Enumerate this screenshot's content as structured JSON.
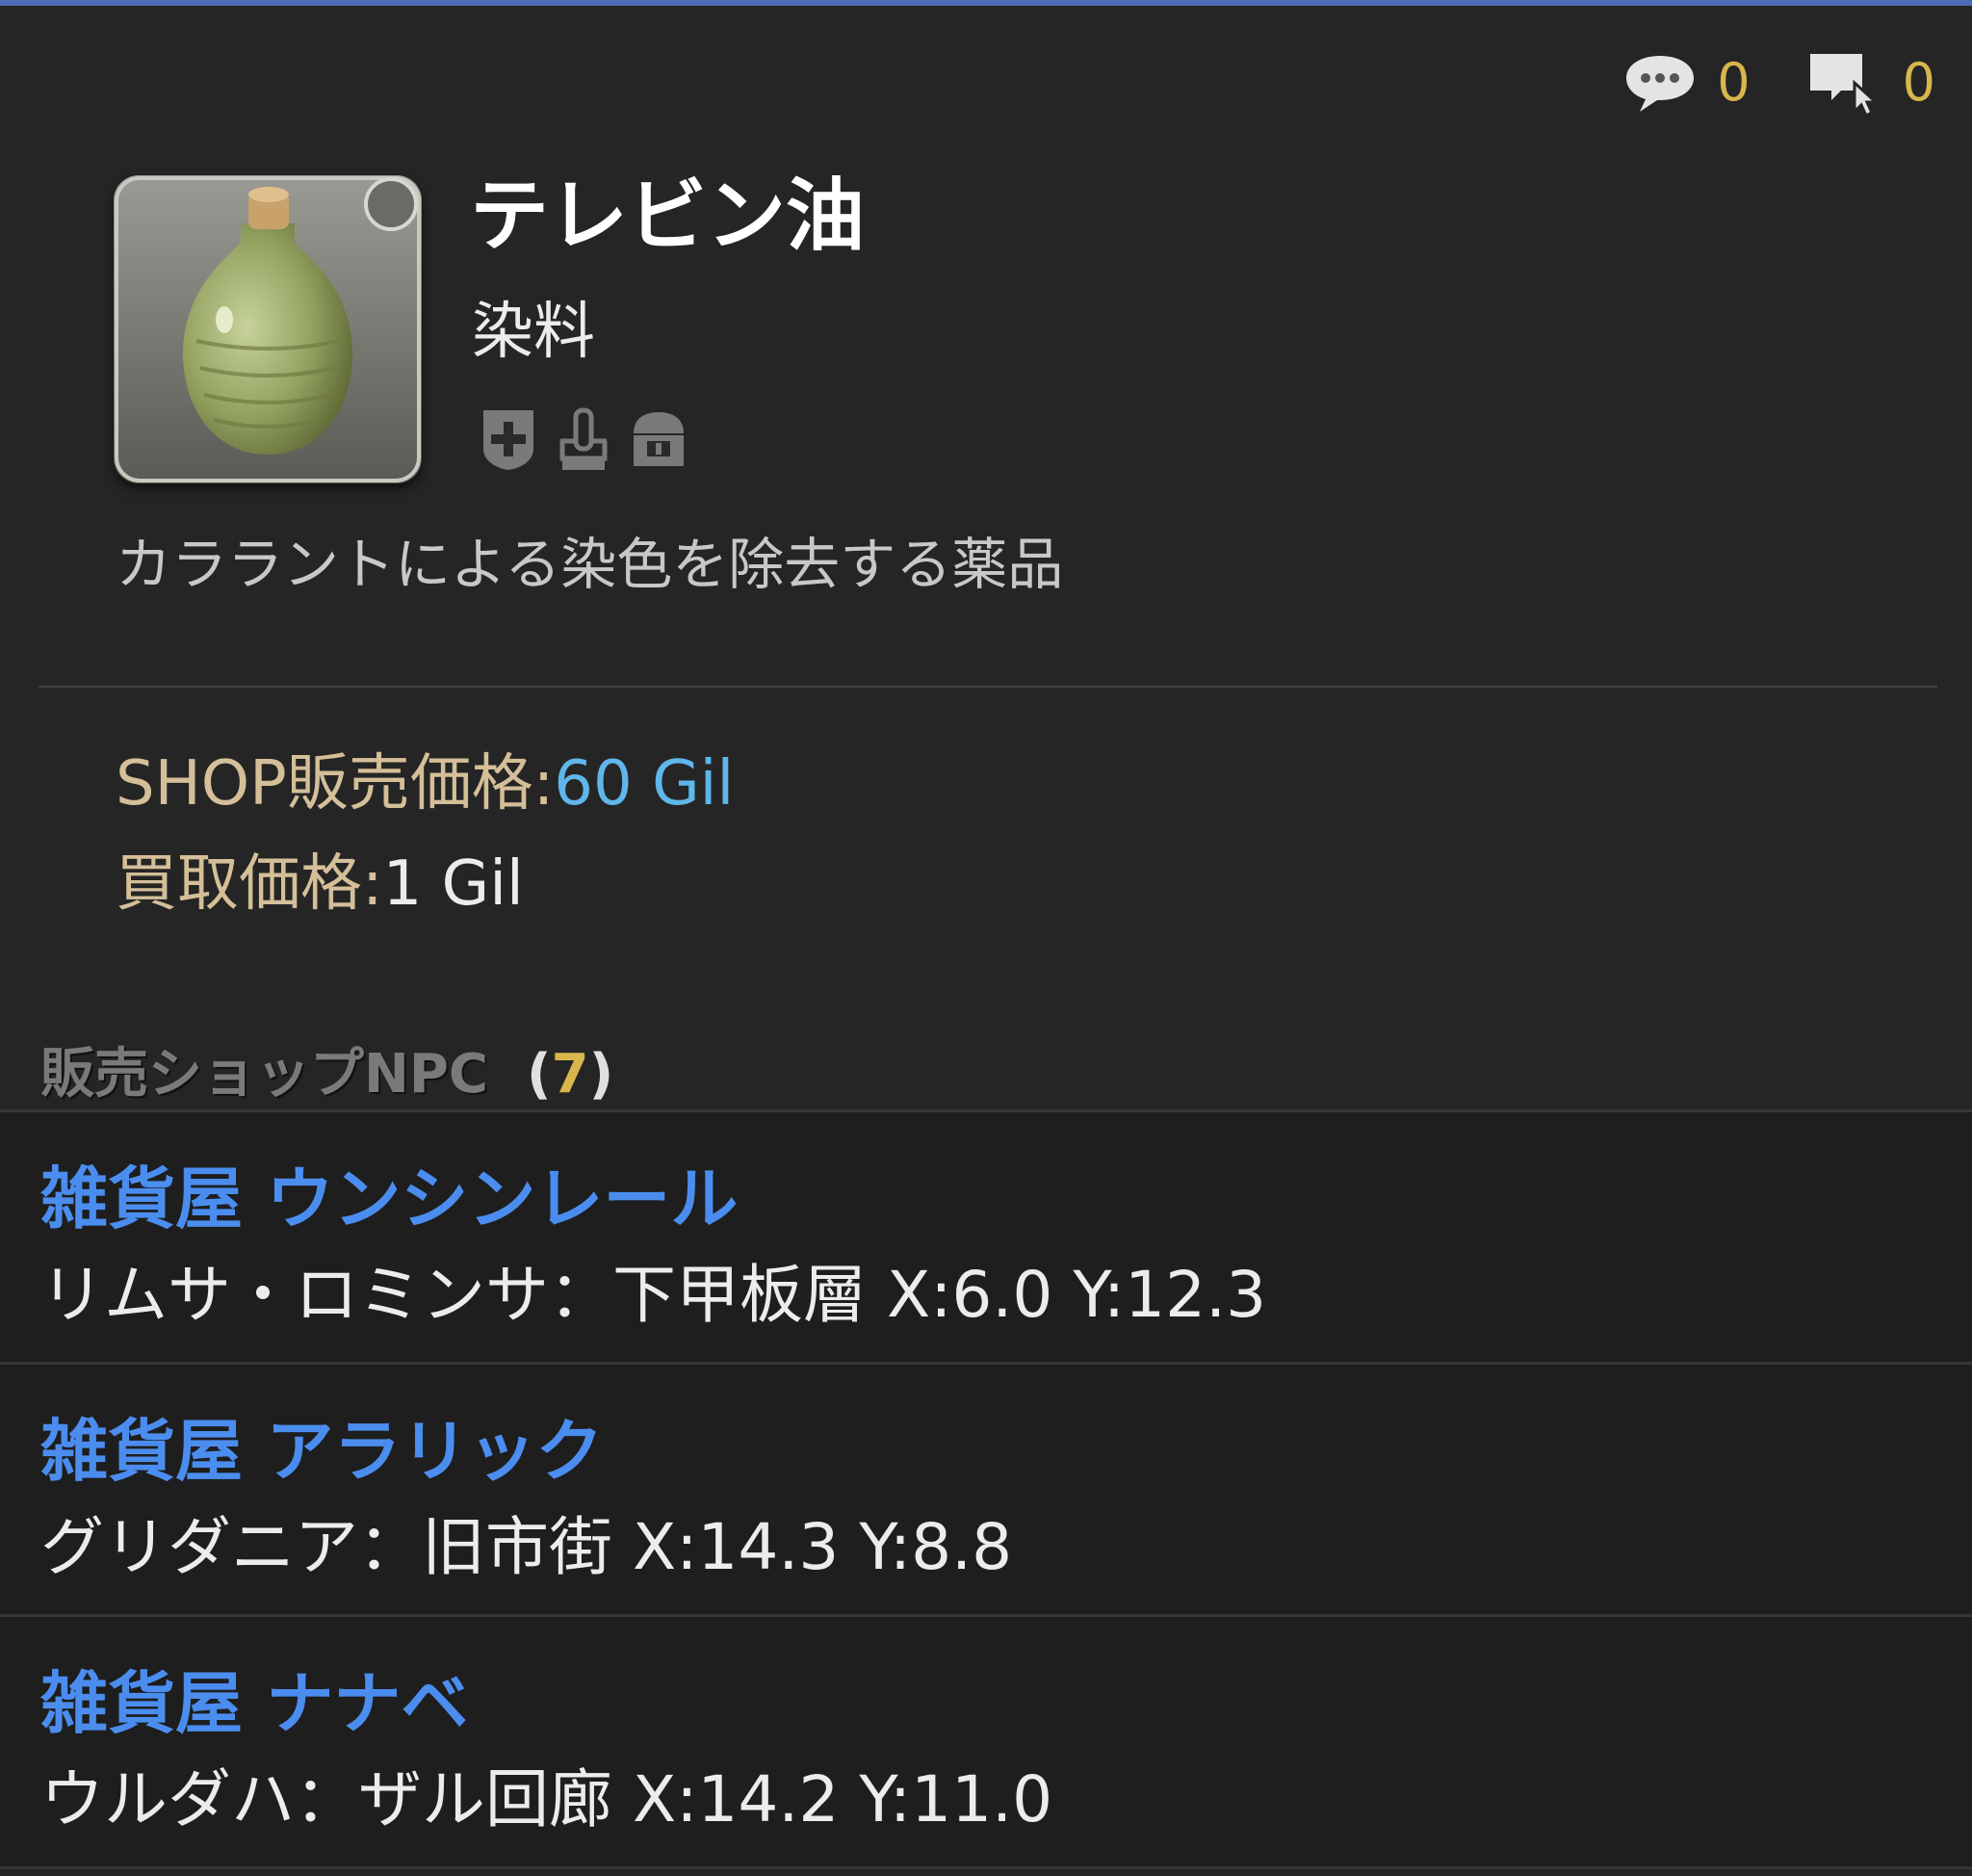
{
  "header": {
    "comments_count": "0",
    "bookmarks_count": "0"
  },
  "item": {
    "icon": "pottery-jar-icon",
    "name": "テレビン油",
    "category": "染料",
    "description": "カララントによる染色を除去する薬品",
    "badges": [
      "plus-badge-icon",
      "hand-badge-icon",
      "chest-badge-icon"
    ]
  },
  "prices": {
    "shop_label": "SHOP販売価格:",
    "shop_value": "60 Gil",
    "buy_label": "買取価格:",
    "buy_value": "1 Gil"
  },
  "npc_section": {
    "title": "販売ショップNPC",
    "count_open": "(",
    "count": "7",
    "count_close": ")",
    "items": [
      {
        "name": "雑貨屋 ウンシンレール",
        "location": "リムサ・ロミンサ：下甲板層 X:6.0 Y:12.3"
      },
      {
        "name": "雑貨屋 アラリック",
        "location": "グリダニア：旧市街 X:14.3 Y:8.8"
      },
      {
        "name": "雑貨屋 ナナベ",
        "location": "ウルダハ：ザル回廊 X:14.2 Y:11.0"
      }
    ]
  },
  "colors": {
    "accent_bar": "#4d6ab4",
    "count_gold": "#d9b64c",
    "npc_link": "#4b8def",
    "shop_price": "#5fb6ea",
    "price_label": "#d4bf99"
  }
}
